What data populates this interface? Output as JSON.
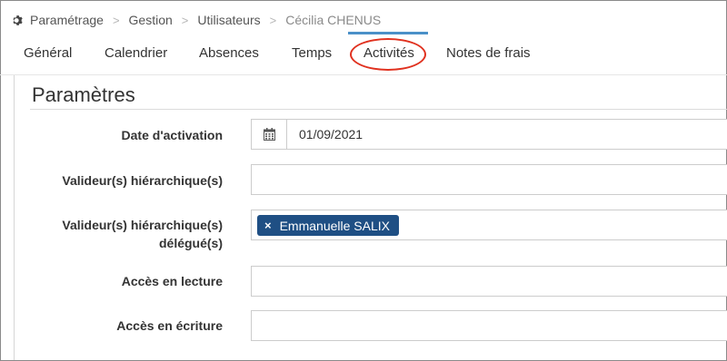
{
  "breadcrumb": {
    "icon": "gear-icon",
    "items": [
      "Paramétrage",
      "Gestion",
      "Utilisateurs",
      "Cécilia CHENUS"
    ],
    "separator": ">"
  },
  "tabs": [
    {
      "label": "Général"
    },
    {
      "label": "Calendrier"
    },
    {
      "label": "Absences"
    },
    {
      "label": "Temps"
    },
    {
      "label": "Activités",
      "active": true
    },
    {
      "label": "Notes de frais"
    }
  ],
  "section": {
    "title": "Paramètres"
  },
  "form": {
    "activation_date": {
      "label": "Date d'activation",
      "value": "01/09/2021",
      "icon": "calendar-icon"
    },
    "validators": {
      "label": "Valideur(s) hiérarchique(s)",
      "value": ""
    },
    "delegated_validators": {
      "label_line1": "Valideur(s) hiérarchique(s)",
      "label_line2": "délégué(s)",
      "tags": [
        {
          "remove": "×",
          "name": "Emmanuelle SALIX"
        }
      ]
    },
    "read_access": {
      "label": "Accès en lecture",
      "value": ""
    },
    "write_access": {
      "label": "Accès en écriture",
      "value": ""
    }
  },
  "colors": {
    "accent": "#4a90c8",
    "tag_bg": "#1f4f84",
    "annotation": "#e0311f"
  }
}
